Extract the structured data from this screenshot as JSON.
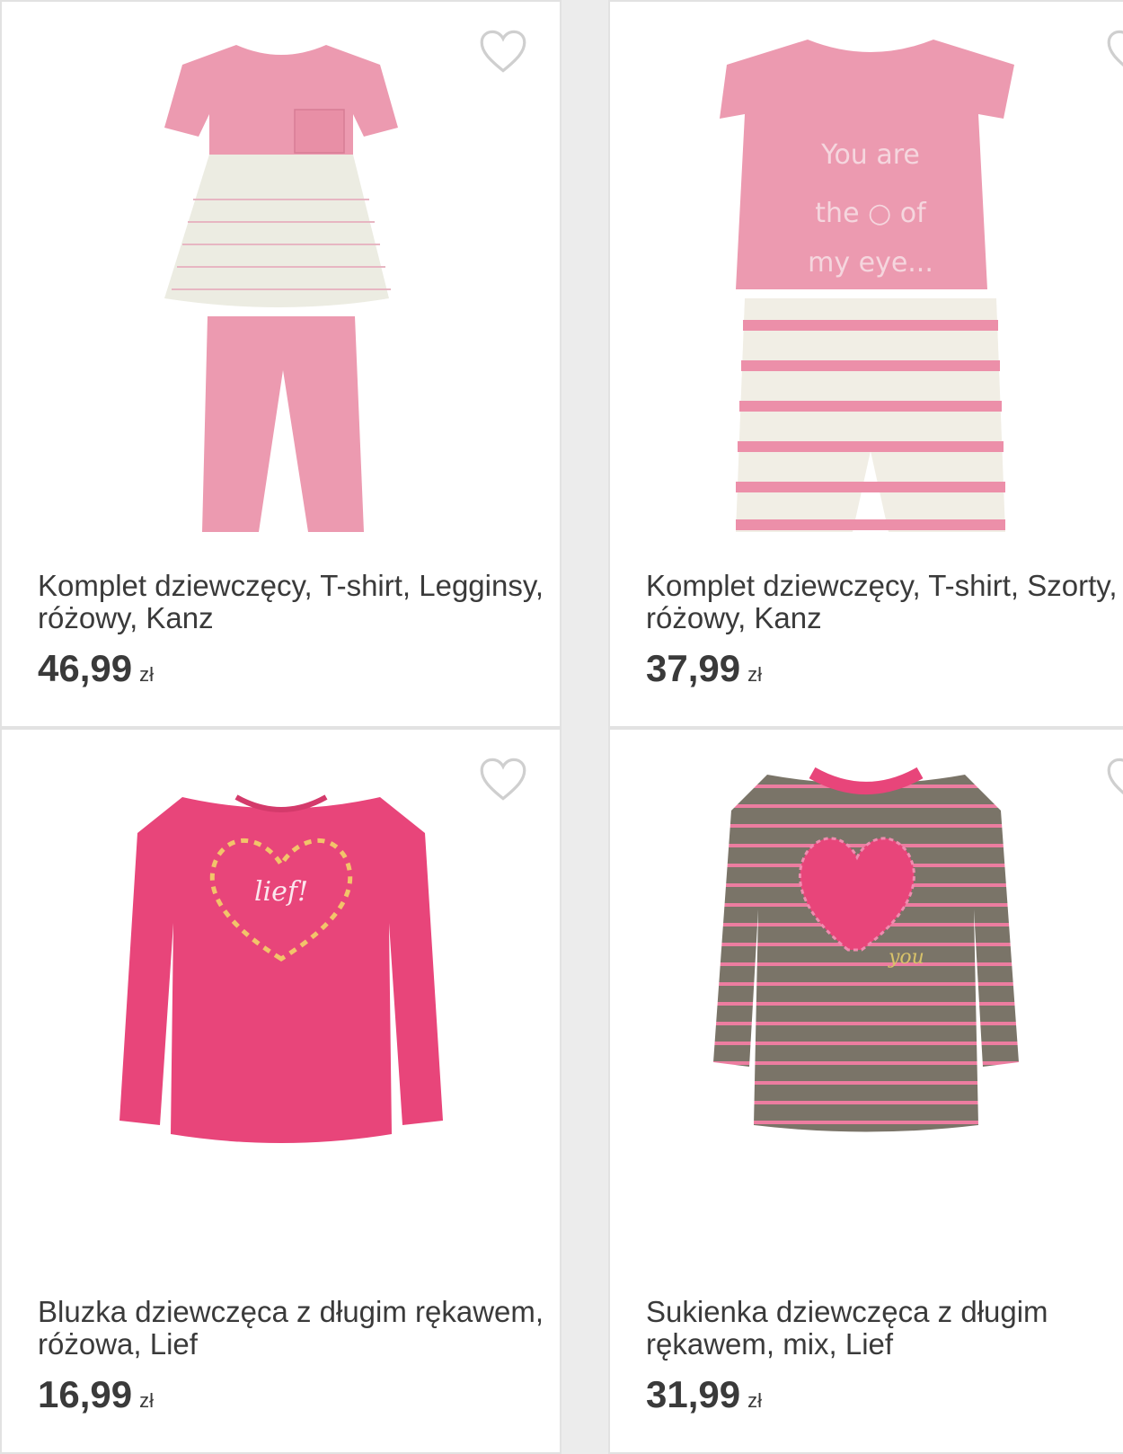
{
  "products": [
    {
      "title": "Komplet dziewczęcy, T-shirt, Legginsy, różowy, Kanz",
      "price": "46,99",
      "currency": "zł",
      "print_text": ""
    },
    {
      "title": "Komplet dziewczęcy, T-shirt, Szorty, różowy, Kanz",
      "price": "37,99",
      "currency": "zł",
      "print_text": "You are the of my eye..."
    },
    {
      "title": "Bluzka dziewczęca z długim rękawem, różowa, Lief",
      "price": "16,99",
      "currency": "zł",
      "print_text": "lief!"
    },
    {
      "title": "Sukienka dziewczęca z długim rękawem, mix, Lief",
      "price": "31,99",
      "currency": "zł",
      "print_text": "you"
    }
  ],
  "icons": {
    "favorite": "heart-outline-icon"
  },
  "colors": {
    "text": "#3a3a3a",
    "heart_outline": "#cfcfcf",
    "pink_light": "#ec9ab0",
    "pink_hot": "#e8457a",
    "grey_knit": "#7a7468"
  }
}
